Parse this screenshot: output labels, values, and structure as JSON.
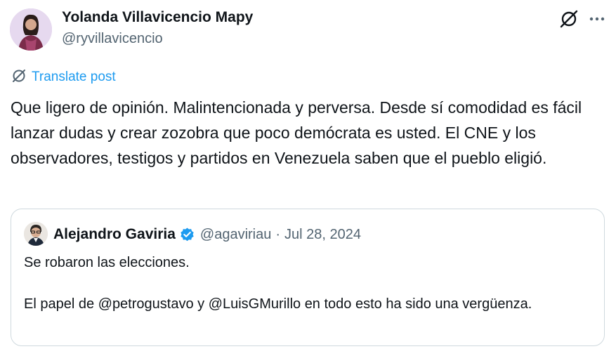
{
  "post": {
    "author": {
      "name": "Yolanda Villavicencio Mapy",
      "handle": "@ryvillavicencio",
      "avatar_icon": "profile-photo"
    },
    "actions": {
      "grok_icon": "grok-slash-circle-icon",
      "more_label": "•••"
    },
    "translate": {
      "label": "Translate post",
      "icon": "translate-globe-icon"
    },
    "text": "Que ligero de opinión. Malintencionada y perversa. Desde sí comodidad es fácil lanzar dudas y crear zozobra que poco demócrata es usted. El CNE y los observadores, testigos y partidos en Venezuela saben que el pueblo eligió.",
    "quote": {
      "author_name": "Alejandro Gaviria",
      "verified": true,
      "handle": "@agaviriau",
      "separator": "·",
      "date": "Jul 28, 2024",
      "line1": "Se robaron las elecciones.",
      "line2": "El papel de @petrogustavo y @LuisGMurillo en todo esto ha sido una vergüenza."
    }
  },
  "colors": {
    "text": "#0f1419",
    "secondary": "#536471",
    "accent": "#1d9bf0",
    "border": "#cfd9de"
  }
}
